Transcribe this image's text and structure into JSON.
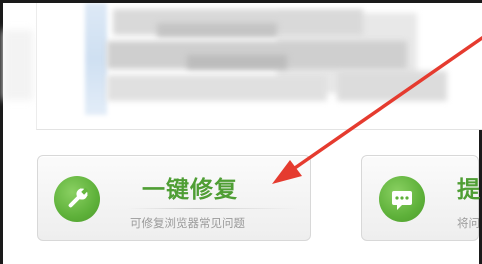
{
  "repair_card": {
    "title": "一键修复",
    "description": "可修复浏览器常见问题",
    "icon": "wrench-icon",
    "accent": "#5eb13a"
  },
  "feedback_card": {
    "title": "提",
    "description": "将问",
    "icon": "chat-bubble-icon",
    "accent": "#5eb13a"
  },
  "annotation": {
    "arrow_color": "#e53b2f"
  }
}
